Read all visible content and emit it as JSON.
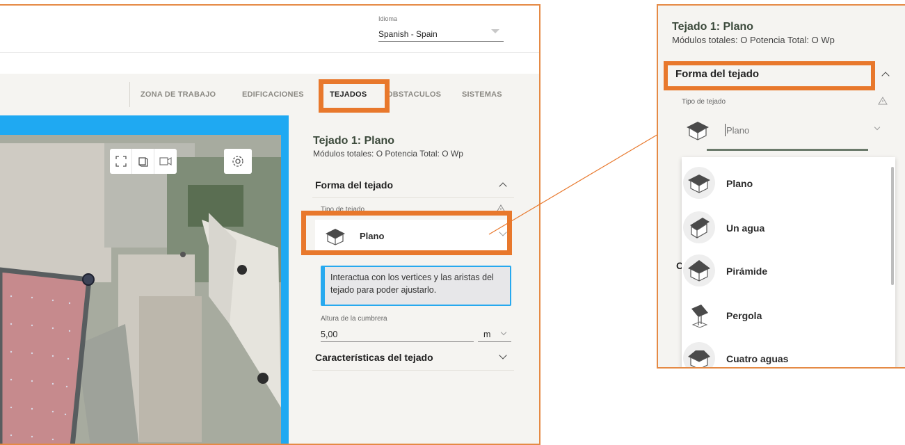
{
  "header": {
    "language_label": "Idioma",
    "language_value": "Spanish - Spain"
  },
  "nav": {
    "items": [
      "ZONA DE TRABAJO",
      "EDIFICACIONES",
      "TEJADOS",
      "OBSTACULOS",
      "SISTEMAS"
    ],
    "active": "TEJADOS"
  },
  "map": {
    "tools": [
      "fullscreen-icon",
      "3d-view-icon",
      "camera-icon"
    ],
    "settings_icon": "gear-icon"
  },
  "panel": {
    "title": "Tejado 1: Plano",
    "subtitle": "Módulos totales: O Potencia Total: O Wp",
    "shape_section": "Forma del tejado",
    "roof_type_label": "Tipo de tejado",
    "roof_type_value": "Plano",
    "info_text": "Interactua con los vertices y las aristas del tejado para poder ajustarlo.",
    "height_label": "Altura de la cumbrera",
    "height_value": "5,00",
    "height_unit": "m",
    "characteristics_section": "Características del tejado"
  },
  "zoom": {
    "title": "Tejado 1: Plano",
    "subtitle": "Módulos totales: O Potencia Total: O Wp",
    "shape_section": "Forma del tejado",
    "roof_type_label": "Tipo de tejado",
    "roof_type_value": "Plano",
    "options": [
      "Plano",
      "Un agua",
      "Pirámide",
      "Pergola",
      "Cuatro aguas"
    ],
    "hidden_letter": "C"
  },
  "colors": {
    "highlight": "#e8782c",
    "accent_blue": "#27a9ef",
    "panel_bg": "#f5f4f1"
  }
}
